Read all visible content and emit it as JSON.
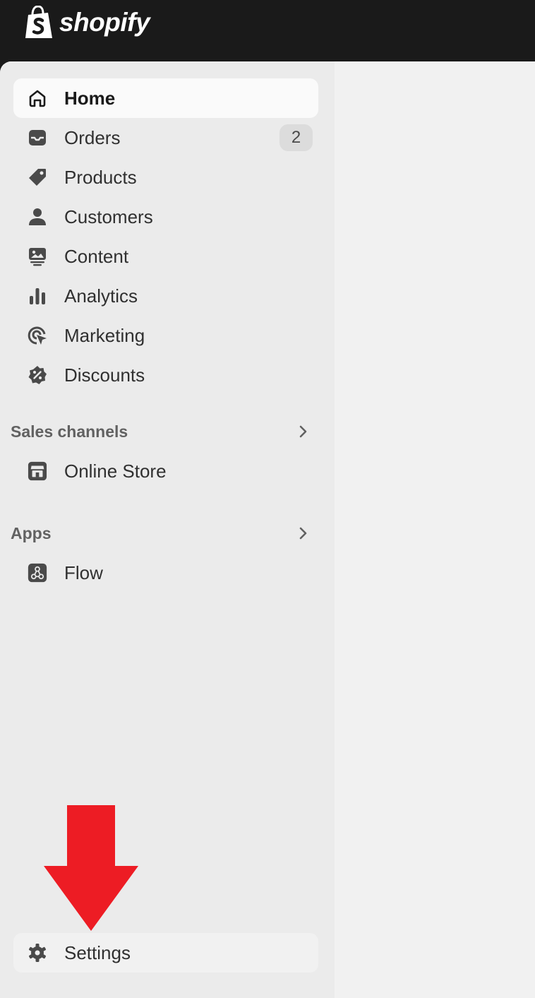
{
  "brand": {
    "name": "shopify",
    "icon": "shopify-bag-icon"
  },
  "nav": {
    "items": [
      {
        "label": "Home",
        "icon": "home-icon",
        "active": true
      },
      {
        "label": "Orders",
        "icon": "inbox-icon",
        "badge": "2"
      },
      {
        "label": "Products",
        "icon": "tag-icon"
      },
      {
        "label": "Customers",
        "icon": "person-icon"
      },
      {
        "label": "Content",
        "icon": "image-content-icon"
      },
      {
        "label": "Analytics",
        "icon": "bar-chart-icon"
      },
      {
        "label": "Marketing",
        "icon": "target-icon"
      },
      {
        "label": "Discounts",
        "icon": "discount-icon"
      }
    ]
  },
  "sales_channels": {
    "title": "Sales channels",
    "items": [
      {
        "label": "Online Store",
        "icon": "store-icon"
      }
    ]
  },
  "apps": {
    "title": "Apps",
    "items": [
      {
        "label": "Flow",
        "icon": "flow-icon"
      }
    ]
  },
  "settings": {
    "label": "Settings",
    "icon": "gear-icon"
  },
  "annotation": {
    "type": "arrow-down",
    "color": "#ed1c24"
  },
  "colors": {
    "topbar": "#1a1a1a",
    "sidebar": "#ebebeb",
    "main": "#f1f1f1",
    "active_item": "#fafafa",
    "text": "#303030"
  }
}
